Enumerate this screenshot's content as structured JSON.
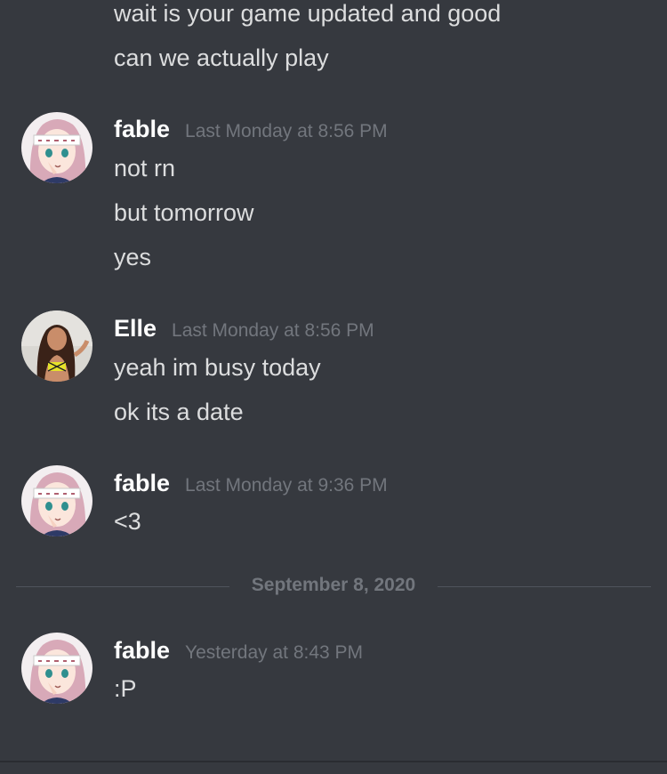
{
  "messages": {
    "prev": {
      "lines": [
        "wait is your game updated and good",
        "can we actually play"
      ]
    },
    "m1": {
      "author": "fable",
      "avatar_icon": "anime-girl-avatar",
      "timestamp": "Last Monday at 8:56 PM",
      "lines": [
        "not rn",
        "but tomorrow",
        "yes"
      ]
    },
    "m2": {
      "author": "Elle",
      "avatar_icon": "photo-avatar",
      "timestamp": "Last Monday at 8:56 PM",
      "lines": [
        "yeah im busy today",
        "ok its a date"
      ]
    },
    "m3": {
      "author": "fable",
      "avatar_icon": "anime-girl-avatar",
      "timestamp": "Last Monday at 9:36 PM",
      "lines": [
        "<3"
      ]
    },
    "m4": {
      "author": "fable",
      "avatar_icon": "anime-girl-avatar",
      "timestamp": "Yesterday at 8:43 PM",
      "lines": [
        ":P"
      ]
    }
  },
  "date_divider": "September 8, 2020",
  "colors": {
    "background": "#36393f",
    "text": "#dcddde",
    "username": "#ffffff",
    "timestamp": "#72767d",
    "divider": "#4f545c"
  }
}
